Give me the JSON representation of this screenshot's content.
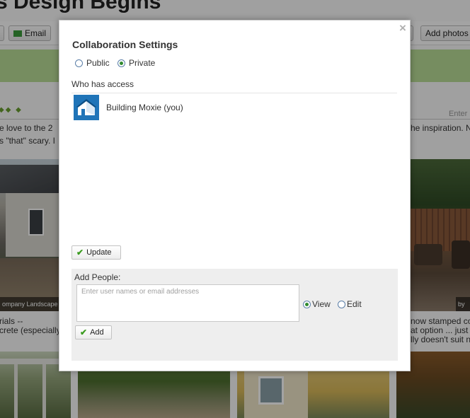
{
  "background": {
    "page_title": "s Design Begins",
    "toolbar": {
      "email_label": "Email",
      "add_photos_label": "Add photos"
    },
    "enter_label": "Enter",
    "text_left_1": "e love to the 2",
    "text_left_2": "s \"that\" scary. I",
    "text_right_1": "he inspiration. N",
    "photo_left_caption": "ompany Landscape",
    "photo_right_caption": "by",
    "text_left_3": "rials --",
    "text_left_4": "crete (especially",
    "text_right_2": "now stamped con",
    "text_right_3": "at option ... just",
    "text_right_4": "lly doesn't suit n"
  },
  "modal": {
    "title": "Collaboration Settings",
    "visibility": [
      {
        "label": "Public",
        "checked": false
      },
      {
        "label": "Private",
        "checked": true
      }
    ],
    "who_has_access_label": "Who has access",
    "members": [
      {
        "name": "Building Moxie (you)"
      }
    ],
    "update_label": "Update",
    "add_people": {
      "label": "Add People:",
      "placeholder": "Enter user names or email addresses",
      "value": "",
      "permissions": [
        {
          "label": "View",
          "checked": true
        },
        {
          "label": "Edit",
          "checked": false
        }
      ],
      "add_label": "Add"
    }
  },
  "colors": {
    "accent_green": "#3a9b1e",
    "green_bar": "#b9dd97",
    "avatar_blue": "#1f74b8"
  },
  "icons": [
    "close-icon",
    "checkmark-icon",
    "house-icon",
    "email-icon"
  ]
}
